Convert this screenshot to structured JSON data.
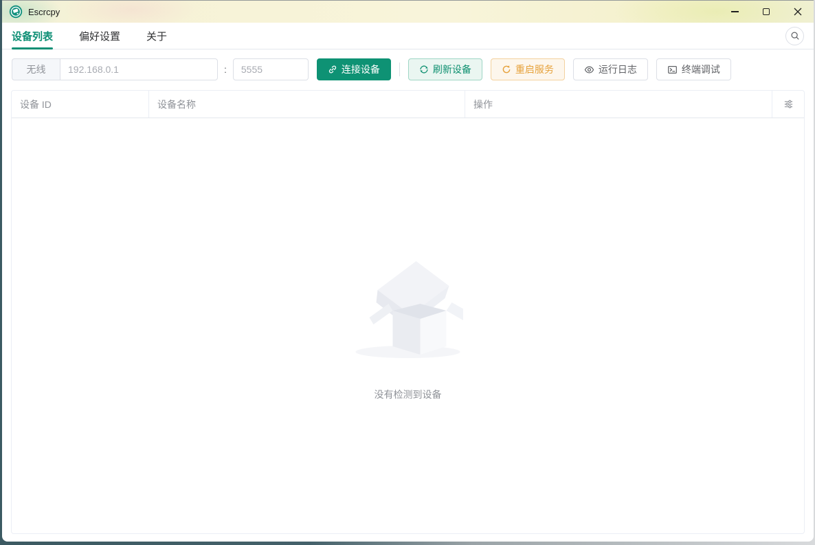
{
  "window": {
    "title": "Escrcpy"
  },
  "tabs": [
    {
      "label": "设备列表",
      "active": true
    },
    {
      "label": "偏好设置",
      "active": false
    },
    {
      "label": "关于",
      "active": false
    }
  ],
  "toolbar": {
    "wireless_label": "无线",
    "ip_placeholder": "192.168.0.1",
    "port_separator": ":",
    "port_placeholder": "5555",
    "connect_label": "连接设备",
    "refresh_label": "刷新设备",
    "restart_label": "重启服务",
    "logs_label": "运行日志",
    "terminal_label": "终端调试"
  },
  "table": {
    "columns": [
      "设备 ID",
      "设备名称",
      "操作"
    ],
    "rows": [],
    "empty_text": "没有检测到设备"
  },
  "icons": {
    "app": "escrcpy-logo",
    "window": [
      "minimize-icon",
      "maximize-icon",
      "close-icon"
    ],
    "search": "search-icon",
    "connect": "link-icon",
    "refresh": "refresh-icon",
    "restart": "refresh-right-icon",
    "logs": "eye-icon",
    "terminal": "terminal-icon",
    "table_settings": "sliders-icon"
  },
  "colors": {
    "primary": "#0e9274",
    "primary_text": "#0e8f75",
    "warning": "#e6a23c",
    "warning_bg": "#fdf6ec",
    "warning_border": "#f3d19e",
    "success_plain_bg": "#eaf6f1",
    "titlebar": "#f7f3d9",
    "desktop_edge": "#3c5a62",
    "header_text": "#909399",
    "border": "#dcdfe6"
  }
}
